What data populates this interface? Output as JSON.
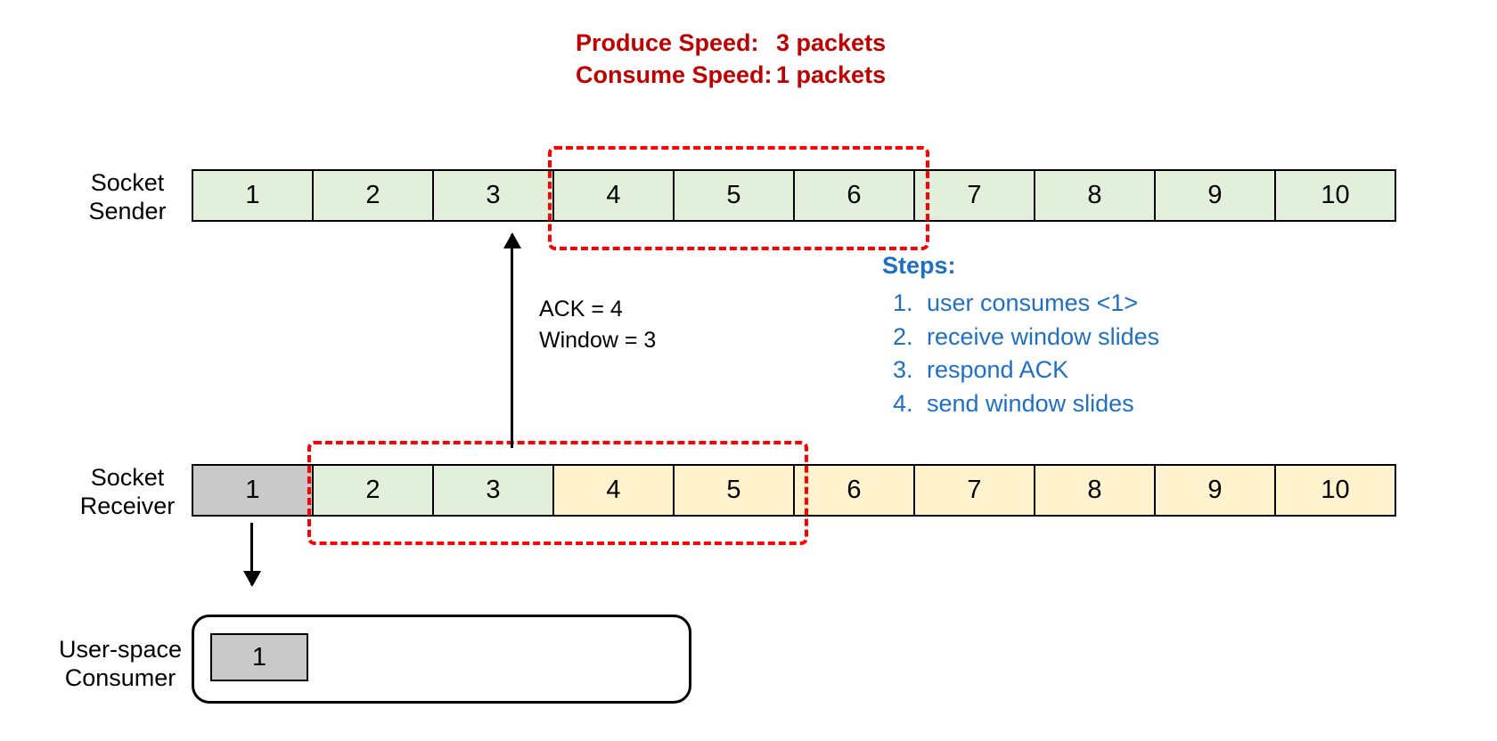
{
  "speeds": {
    "produce_label": "Produce Speed:",
    "produce_value": "3 packets",
    "consume_label": "Consume Speed:",
    "consume_value": "1 packets"
  },
  "labels": {
    "sender_line1": "Socket",
    "sender_line2": "Sender",
    "receiver_line1": "Socket",
    "receiver_line2": "Receiver",
    "consumer_line1": "User-space",
    "consumer_line2": "Consumer"
  },
  "sender_cells": [
    "1",
    "2",
    "3",
    "4",
    "5",
    "6",
    "7",
    "8",
    "9",
    "10"
  ],
  "receiver": {
    "c1": "1",
    "c2": "2",
    "c3": "3",
    "c4": "4",
    "c5": "5",
    "c6": "6",
    "c7": "7",
    "c8": "8",
    "c9": "9",
    "c10": "10"
  },
  "ack": {
    "line1": "ACK = 4",
    "line2": "Window = 3"
  },
  "steps": {
    "title": "Steps:",
    "s1": "user consumes <1>",
    "s2": "receive window slides",
    "s3": "respond ACK",
    "s4": "send window slides"
  },
  "consumer_packet": "1",
  "chart_data": {
    "type": "diagram",
    "title": "TCP Sliding Window Flow Control",
    "produce_speed_packets": 3,
    "consume_speed_packets": 1,
    "sender_buffer": [
      1,
      2,
      3,
      4,
      5,
      6,
      7,
      8,
      9,
      10
    ],
    "receiver_buffer": [
      {
        "seq": 1,
        "state": "consumed"
      },
      {
        "seq": 2,
        "state": "received"
      },
      {
        "seq": 3,
        "state": "received"
      },
      {
        "seq": 4,
        "state": "available"
      },
      {
        "seq": 5,
        "state": "available"
      },
      {
        "seq": 6,
        "state": "available"
      },
      {
        "seq": 7,
        "state": "available"
      },
      {
        "seq": 8,
        "state": "available"
      },
      {
        "seq": 9,
        "state": "available"
      },
      {
        "seq": 10,
        "state": "available"
      }
    ],
    "send_window": {
      "start": 4,
      "end": 6,
      "size": 3
    },
    "receive_window": {
      "start": 2,
      "end": 6,
      "size": 5
    },
    "ack_message": {
      "ack": 4,
      "window": 3
    },
    "user_space_contents": [
      1
    ],
    "steps": [
      "user consumes <1>",
      "receive window slides",
      "respond ACK",
      "send window slides"
    ]
  }
}
